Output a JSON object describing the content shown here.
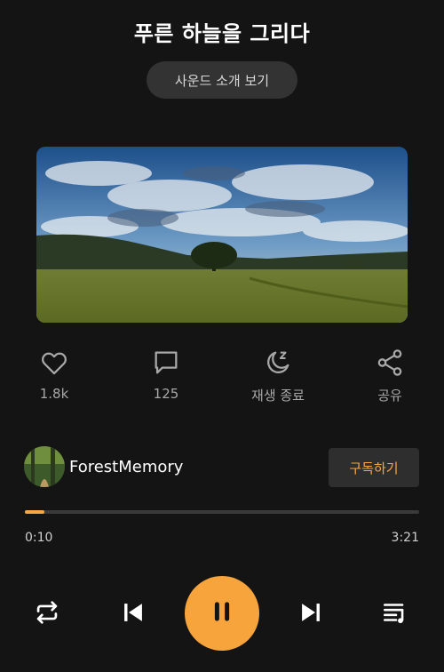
{
  "header": {
    "title": "푸른 하늘을 그리다",
    "intro_button_label": "사운드 소개 보기"
  },
  "actions": {
    "like_count": "1.8k",
    "comment_count": "125",
    "sleep_timer_label": "재생 종료",
    "share_label": "공유"
  },
  "creator": {
    "name": "ForestMemory",
    "subscribe_label": "구독하기"
  },
  "playback": {
    "current_time": "0:10",
    "total_time": "3:21",
    "progress_fraction": 0.05,
    "state": "playing"
  },
  "icons": {
    "like": "heart-icon",
    "comment": "comment-icon",
    "sleep_timer": "moon-icon",
    "share": "share-icon",
    "repeat": "repeat-icon",
    "previous": "skip-previous-icon",
    "pause": "pause-icon",
    "next": "skip-next-icon",
    "playlist": "playlist-icon"
  },
  "colors": {
    "background": "#141414",
    "accent": "#f8a43c",
    "muted_text": "#a8a8a8"
  }
}
